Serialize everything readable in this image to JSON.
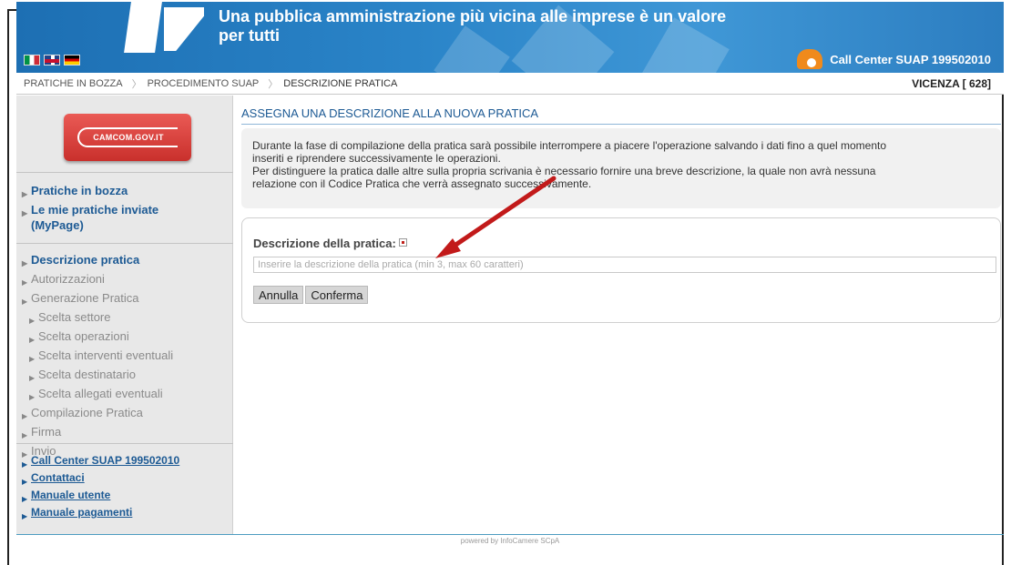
{
  "header": {
    "slogan_line1": "Una pubblica amministrazione più vicina alle imprese è un valore",
    "slogan_line2": "per tutti",
    "call_center": "Call Center SUAP 199502010",
    "flags": [
      "flag-italy-icon",
      "flag-uk-icon",
      "flag-germany-icon"
    ]
  },
  "breadcrumb": {
    "items": [
      "PRATICHE IN BOZZA",
      "PROCEDIMENTO SUAP",
      "DESCRIZIONE PRATICA"
    ],
    "region": "VICENZA [ 628]"
  },
  "sidebar": {
    "logo_text": "CAMCOM.GOV.IT",
    "top_links": [
      "Pratiche in bozza",
      "Le mie pratiche inviate (MyPage)"
    ],
    "steps": [
      {
        "label": "Descrizione pratica",
        "level": 0,
        "state": "active"
      },
      {
        "label": "Autorizzazioni",
        "level": 0,
        "state": "disabled"
      },
      {
        "label": "Generazione Pratica",
        "level": 0,
        "state": "disabled"
      },
      {
        "label": "Scelta settore",
        "level": 1,
        "state": "disabled"
      },
      {
        "label": "Scelta operazioni",
        "level": 1,
        "state": "disabled"
      },
      {
        "label": "Scelta interventi eventuali",
        "level": 1,
        "state": "disabled"
      },
      {
        "label": "Scelta destinatario",
        "level": 1,
        "state": "disabled"
      },
      {
        "label": "Scelta allegati eventuali",
        "level": 1,
        "state": "disabled"
      },
      {
        "label": "Compilazione Pratica",
        "level": 0,
        "state": "disabled"
      },
      {
        "label": "Firma",
        "level": 0,
        "state": "disabled"
      },
      {
        "label": "Invio",
        "level": 0,
        "state": "disabled"
      }
    ],
    "bottom_links": [
      "Call Center SUAP 199502010",
      "Contattaci",
      "Manuale utente",
      "Manuale pagamenti"
    ]
  },
  "main": {
    "title": "ASSEGNA UNA DESCRIZIONE ALLA NUOVA PRATICA",
    "info_line1": "Durante la fase di compilazione della pratica sarà possibile interrompere a piacere l'operazione salvando i dati fino a quel momento",
    "info_line2": "inseriti e riprendere successivamente le operazioni.",
    "info_line3": "Per distinguere la pratica dalle altre sulla propria scrivania è necessario fornire una breve descrizione, la quale non avrà nessuna",
    "info_line4": "relazione con il Codice Pratica che verrà assegnato successivamente.",
    "form_label": "Descrizione della pratica:",
    "input_value": "",
    "input_placeholder": "Inserire la descrizione della pratica (min 3, max 60 caratteri)",
    "cancel_label": "Annulla",
    "confirm_label": "Conferma"
  },
  "footer": {
    "text": "powered by InfoCamere SCpA"
  },
  "colors": {
    "header_blue": "#2a84c8",
    "link_blue": "#1d5a94",
    "logo_red": "#c9302c",
    "annotation_red": "#c21a1a"
  }
}
